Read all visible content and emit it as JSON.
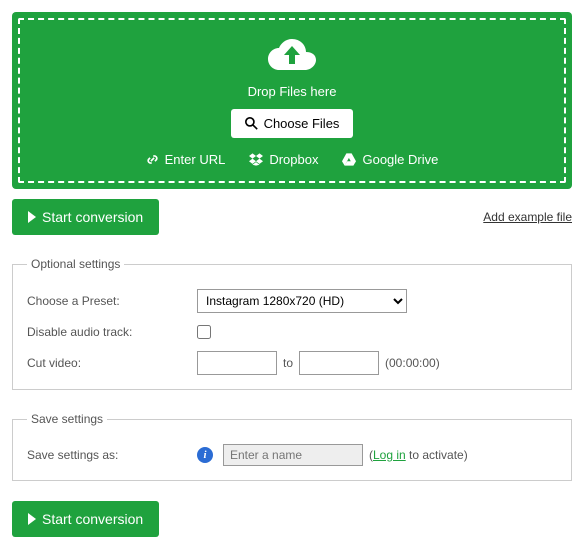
{
  "dropzone": {
    "drop_text": "Drop Files here",
    "choose_label": "Choose Files",
    "enter_url": "Enter URL",
    "dropbox": "Dropbox",
    "gdrive": "Google Drive"
  },
  "buttons": {
    "start_conversion": "Start conversion",
    "add_example": "Add example file"
  },
  "optional": {
    "legend": "Optional settings",
    "preset_label": "Choose a Preset:",
    "preset_value": "Instagram 1280x720 (HD)",
    "disable_audio_label": "Disable audio track:",
    "cut_video_label": "Cut video:",
    "to_text": "to",
    "time_hint": "(00:00:00)"
  },
  "save": {
    "legend": "Save settings",
    "label": "Save settings as:",
    "placeholder": "Enter a name",
    "paren_open": "(",
    "login_text": "Log in",
    "activate_text": " to activate)"
  }
}
